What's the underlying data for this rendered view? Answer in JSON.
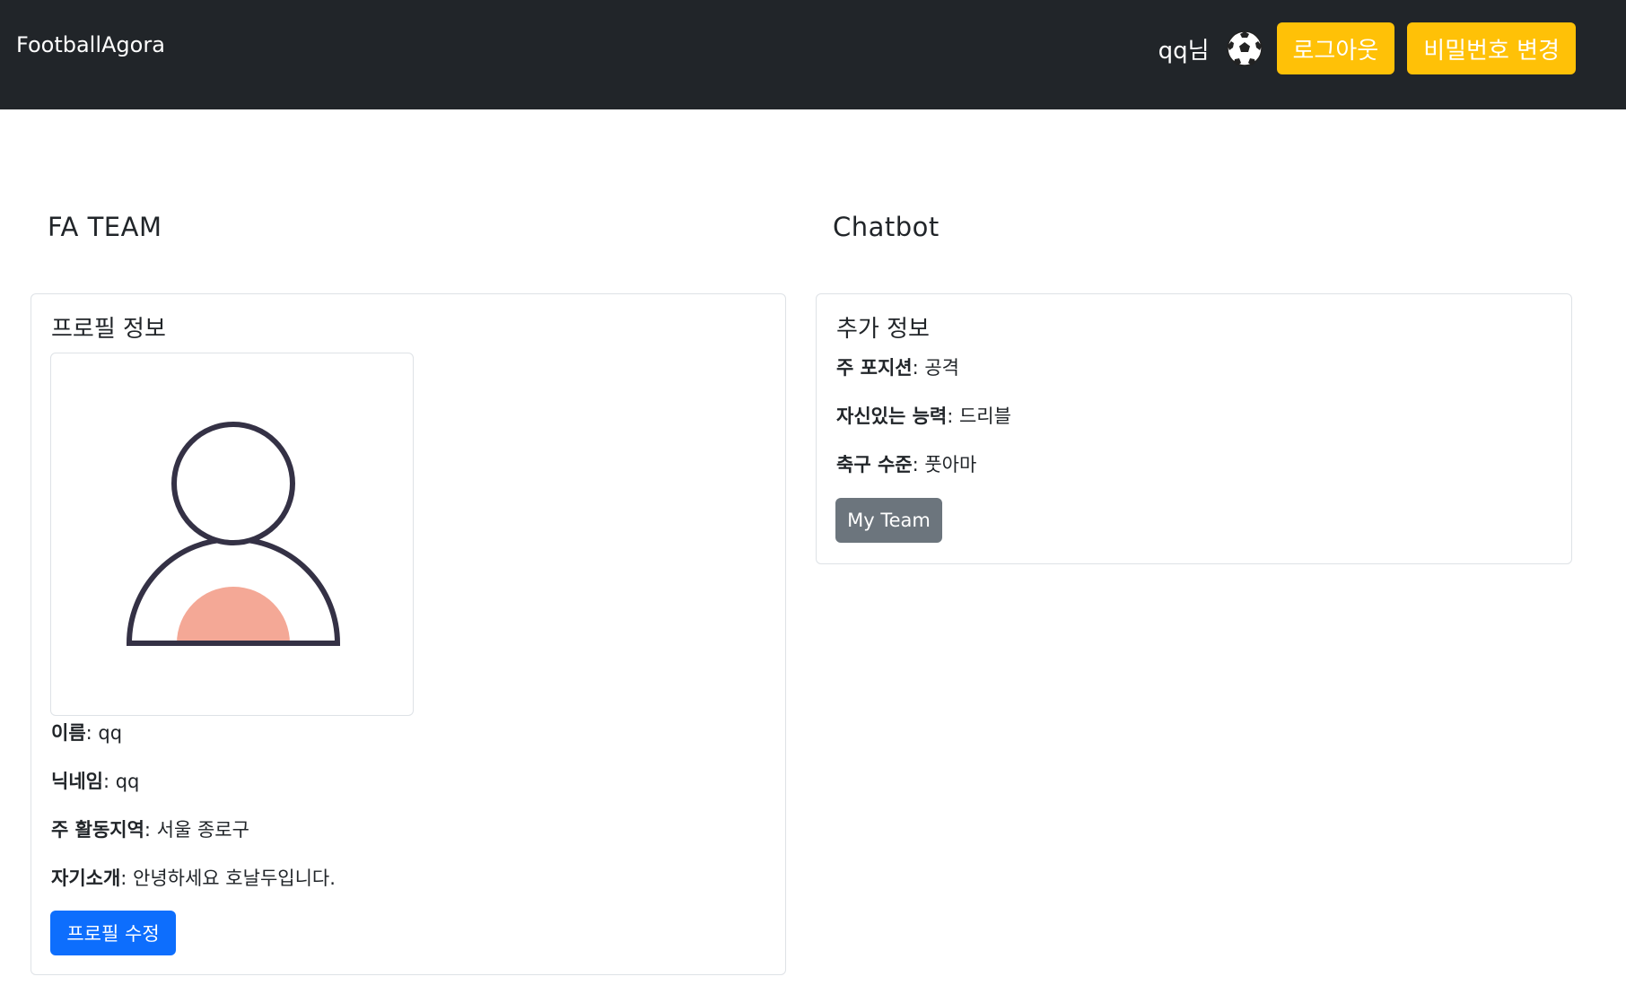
{
  "navbar": {
    "brand": "FootballAgora",
    "greeting": "qq님",
    "icon": "soccer-ball-icon",
    "logout_label": "로그아웃",
    "change_password_label": "비밀번호 변경"
  },
  "sections": {
    "left_title": "FA TEAM",
    "right_title": "Chatbot"
  },
  "profile_card": {
    "title": "프로필 정보",
    "avatar_icon": "user-avatar-icon",
    "fields": [
      {
        "label": "이름",
        "value": ": qq"
      },
      {
        "label": "닉네임",
        "value": ": qq"
      },
      {
        "label": "주 활동지역",
        "value": ": 서울 종로구"
      },
      {
        "label": "자기소개",
        "value": ": 안녕하세요 호날두입니다."
      }
    ],
    "edit_button": "프로필 수정"
  },
  "extra_card": {
    "title": "추가 정보",
    "fields": [
      {
        "label": "주 포지션",
        "value": ": 공격"
      },
      {
        "label": "자신있는 능력",
        "value": ": 드리블"
      },
      {
        "label": "축구 수준",
        "value": ": 풋아마"
      }
    ],
    "my_team_button": "My Team"
  },
  "colors": {
    "navbar_bg": "#212529",
    "warning": "#ffc107",
    "primary": "#0d6efd",
    "secondary": "#6c757d",
    "avatar_accent": "#f4a896",
    "avatar_stroke": "#343145"
  }
}
